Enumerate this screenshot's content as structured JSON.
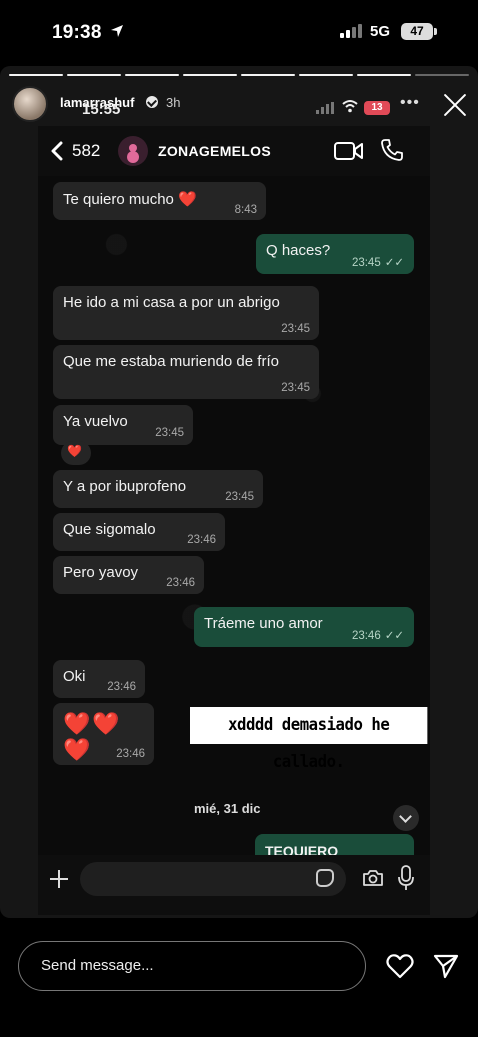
{
  "os_status": {
    "time": "19:38",
    "network": "5G",
    "battery": "47"
  },
  "story": {
    "username": "lamarrashuf",
    "ago": "3h"
  },
  "inner_status": {
    "time": "15:55",
    "battery": "13"
  },
  "chat_header": {
    "back_count": "582",
    "group_name": "ZONAGEMELOS"
  },
  "messages": [
    {
      "text": "Te quiero mucho ❤️",
      "time": "8:43",
      "dir": "in"
    },
    {
      "text": "Q haces?",
      "time": "23:45",
      "dir": "out"
    },
    {
      "text": "He ido a mi casa a por un abrigo",
      "time": "23:45",
      "dir": "in"
    },
    {
      "text": "Que me estaba muriendo de frío",
      "time": "23:45",
      "dir": "in"
    },
    {
      "text": "Ya vuelvo",
      "time": "23:45",
      "dir": "in"
    },
    {
      "text": "❤️",
      "time": "",
      "dir": "reaction"
    },
    {
      "text": "Y a por ibuprofeno",
      "time": "23:45",
      "dir": "in"
    },
    {
      "text": "Que sigomalo",
      "time": "23:46",
      "dir": "in"
    },
    {
      "text": "Pero yavoy",
      "time": "23:46",
      "dir": "in"
    },
    {
      "text": "Tráeme uno amor",
      "time": "23:46",
      "dir": "out"
    },
    {
      "text": "Oki",
      "time": "23:46",
      "dir": "in"
    },
    {
      "text": "❤️❤️❤️",
      "time": "23:46",
      "dir": "in"
    },
    {
      "text": "TEQUIERO",
      "time": "",
      "dir": "out"
    }
  ],
  "date_separator": "mié, 31 dic",
  "overlay_caption": "xdddd demasiado he callado.",
  "bottom_bar": {
    "placeholder": "Send message..."
  },
  "colors": {
    "incoming": "#252525",
    "outgoing": "#1a4d3a",
    "battery_low": "#e14a57"
  },
  "icons": [
    "location-arrow-icon",
    "signal-icon",
    "close-icon",
    "verified-icon",
    "wifi-icon",
    "back-chevron-icon",
    "video-call-icon",
    "phone-icon",
    "plus-icon",
    "sticker-icon",
    "camera-icon",
    "mic-icon",
    "heart-icon",
    "share-icon",
    "chevron-down-icon"
  ]
}
